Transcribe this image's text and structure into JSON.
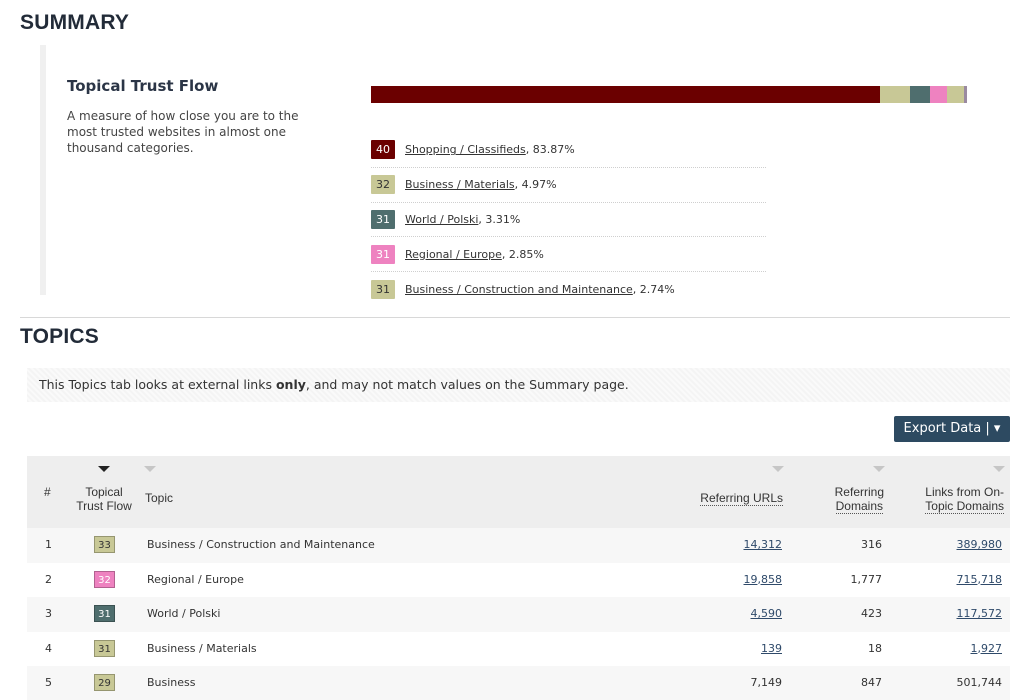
{
  "summary": {
    "section_title": "SUMMARY",
    "heading": "Topical Trust Flow",
    "description": "A measure of how close you are to the most trusted websites in almost one thousand categories.",
    "bar_segments": [
      {
        "label": "Shopping / Classifieds",
        "percent": 83.87,
        "color": "#6b0000"
      },
      {
        "label": "Business / Materials",
        "percent": 4.97,
        "color": "#c8c896"
      },
      {
        "label": "World / Polski",
        "percent": 3.31,
        "color": "#4f6e6e"
      },
      {
        "label": "Regional / Europe",
        "percent": 2.85,
        "color": "#ee82c0"
      },
      {
        "label": "Business / Construction and Maintenance",
        "percent": 2.74,
        "color": "#c8c896"
      },
      {
        "label": "other",
        "percent": 0.5,
        "color": "#9a8aa0"
      }
    ],
    "topics": [
      {
        "score": "40",
        "label": "Shopping / Classifieds",
        "pct": ", 83.87%",
        "bg": "#6b0000",
        "fg": "#ffffff"
      },
      {
        "score": "32",
        "label": "Business / Materials",
        "pct": ", 4.97%",
        "bg": "#c8c896",
        "fg": "#333333"
      },
      {
        "score": "31",
        "label": "World / Polski",
        "pct": ", 3.31%",
        "bg": "#4f6e6e",
        "fg": "#ffffff"
      },
      {
        "score": "31",
        "label": "Regional / Europe",
        "pct": ", 2.85%",
        "bg": "#ee82c0",
        "fg": "#ffffff"
      },
      {
        "score": "31",
        "label": "Business / Construction and Maintenance",
        "pct": ", 2.74%",
        "bg": "#c8c896",
        "fg": "#333333"
      }
    ]
  },
  "topics_section": {
    "section_title": "TOPICS",
    "notice_before": "This Topics tab looks at external links ",
    "notice_bold": "only",
    "notice_after": ", and may not match values on the Summary page.",
    "export_label": "Export Data | ▾"
  },
  "table": {
    "headers": {
      "num": "#",
      "ttf_line1": "Topical",
      "ttf_line2": "Trust Flow",
      "topic": "Topic",
      "urls": "Referring URLs",
      "domains_line1": "Referring",
      "domains_line2": "Domains",
      "links_line1": "Links from On-",
      "links_line2": "Topic Domains"
    },
    "rows": [
      {
        "num": "1",
        "score": "33",
        "bg": "#c8c896",
        "fg": "#333333",
        "topic": "Business / Construction and Maintenance",
        "urls": "14,312",
        "domains": "316",
        "links": "389,980"
      },
      {
        "num": "2",
        "score": "32",
        "bg": "#ee82c0",
        "fg": "#ffffff",
        "topic": "Regional / Europe",
        "urls": "19,858",
        "domains": "1,777",
        "links": "715,718"
      },
      {
        "num": "3",
        "score": "31",
        "bg": "#4f6e6e",
        "fg": "#ffffff",
        "topic": "World / Polski",
        "urls": "4,590",
        "domains": "423",
        "links": "117,572"
      },
      {
        "num": "4",
        "score": "31",
        "bg": "#c8c896",
        "fg": "#333333",
        "topic": "Business / Materials",
        "urls": "139",
        "domains": "18",
        "links": "1,927"
      },
      {
        "num": "5",
        "score": "29",
        "bg": "#c8c896",
        "fg": "#333333",
        "topic": "Business",
        "urls": "7,149",
        "domains": "847",
        "links": "501,744"
      }
    ]
  }
}
